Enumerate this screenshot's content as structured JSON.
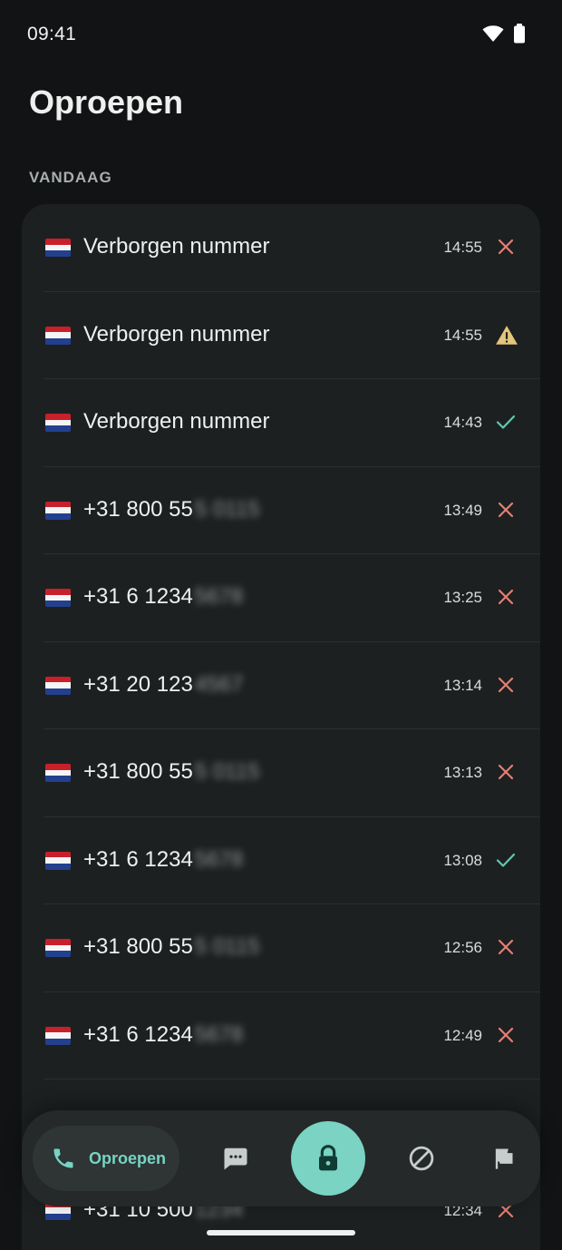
{
  "status_bar": {
    "time": "09:41",
    "icons": [
      "wifi-icon",
      "battery-icon"
    ]
  },
  "page": {
    "title": "Oproepen",
    "section_label": "VANDAAG"
  },
  "calls": [
    {
      "flag": "nl-flag-icon",
      "number_visible": "Verborgen nummer",
      "number_hidden": "",
      "time": "14:55",
      "status": "missed"
    },
    {
      "flag": "nl-flag-icon",
      "number_visible": "Verborgen nummer",
      "number_hidden": "",
      "time": "14:55",
      "status": "warning"
    },
    {
      "flag": "nl-flag-icon",
      "number_visible": "Verborgen nummer",
      "number_hidden": "",
      "time": "14:43",
      "status": "answered"
    },
    {
      "flag": "nl-flag-icon",
      "number_visible": "+31 800 55",
      "number_hidden": "5 0115",
      "time": "13:49",
      "status": "missed"
    },
    {
      "flag": "nl-flag-icon",
      "number_visible": "+31 6 1234",
      "number_hidden": "5678",
      "time": "13:25",
      "status": "missed"
    },
    {
      "flag": "nl-flag-icon",
      "number_visible": "+31 20 123",
      "number_hidden": "4567",
      "time": "13:14",
      "status": "missed"
    },
    {
      "flag": "nl-flag-icon",
      "number_visible": "+31 800 55",
      "number_hidden": "5 0115",
      "time": "13:13",
      "status": "missed"
    },
    {
      "flag": "nl-flag-icon",
      "number_visible": "+31 6 1234",
      "number_hidden": "5678",
      "time": "13:08",
      "status": "answered"
    },
    {
      "flag": "nl-flag-icon",
      "number_visible": "+31 800 55",
      "number_hidden": "5 0115",
      "time": "12:56",
      "status": "missed"
    },
    {
      "flag": "nl-flag-icon",
      "number_visible": "+31 6 1234",
      "number_hidden": "5678",
      "time": "12:49",
      "status": "missed"
    },
    {
      "flag": "nl-flag-icon",
      "number_visible": "",
      "number_hidden": "",
      "time": "",
      "status": "missed"
    },
    {
      "flag": "nl-flag-icon",
      "number_visible": "+31 10 500",
      "number_hidden": "1234",
      "time": "12:34",
      "status": "missed"
    }
  ],
  "bottom_nav": {
    "active_label": "Oproepen",
    "items": [
      "phone-icon",
      "message-icon",
      "lock-icon",
      "block-icon",
      "flag-icon"
    ]
  },
  "colors": {
    "background": "#121314",
    "card": "#1d2021",
    "accent": "#7ad3c3",
    "missed": "#e57e73",
    "warning": "#e3c67c",
    "answered": "#5fc9b0"
  }
}
